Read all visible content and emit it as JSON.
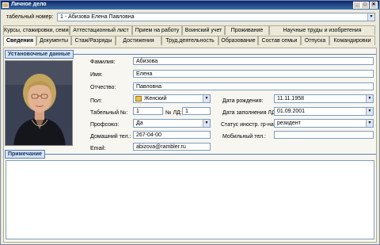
{
  "window": {
    "title": "Личное дело"
  },
  "record": {
    "label": "табельный номер:",
    "value": "1 - Абизова Елена Павловна"
  },
  "tabs_row1": [
    "Курсы, стажировки, семинары",
    "Аттестационный лист",
    "Прием на работу",
    "Воинский учет",
    "Проживание",
    "Научные труды и изобретения"
  ],
  "tabs_row2": [
    "Сведения",
    "Документы",
    "Стаж/Разряды",
    "Достижения",
    "Труд.деятельность",
    "Образование",
    "Состав семьи",
    "Отпуска",
    "Командировки"
  ],
  "active_tab": "Сведения",
  "section_main": "Установочные данные",
  "section_note": "Примечание",
  "fields": {
    "lastname": {
      "label": "Фамилия:",
      "value": "Абизова"
    },
    "firstname": {
      "label": "Имя:",
      "value": "Елена"
    },
    "patronymic": {
      "label": "Отчество:",
      "value": "Павловна"
    },
    "gender": {
      "label": "Пол:",
      "value": "Женский"
    },
    "tabnum": {
      "label": "Табельный №:",
      "value": "1"
    },
    "ld_num": {
      "label": "№ ЛД:",
      "value": "1"
    },
    "union": {
      "label": "Профсоюз:",
      "value": "Да"
    },
    "home_phone": {
      "label": "Домашний тел.:",
      "value": "267-04-00"
    },
    "email": {
      "label": "Email:",
      "value": "abizova@rambler.ru"
    },
    "birth_date": {
      "label": "Дата рождения:",
      "value": "11.11.1958"
    },
    "fill_date": {
      "label": "Дата заполнения ЛД:",
      "value": "01.09.2001"
    },
    "foreign_status": {
      "label": "Статус иностр. гр-на:",
      "value": "резидент"
    },
    "mobile": {
      "label": "Мобильный тел.:",
      "value": ""
    }
  },
  "note": "",
  "colors": {
    "titlebar": "#0a246a",
    "panel": "#f7f6f1",
    "accent": "#5b7fb8"
  }
}
